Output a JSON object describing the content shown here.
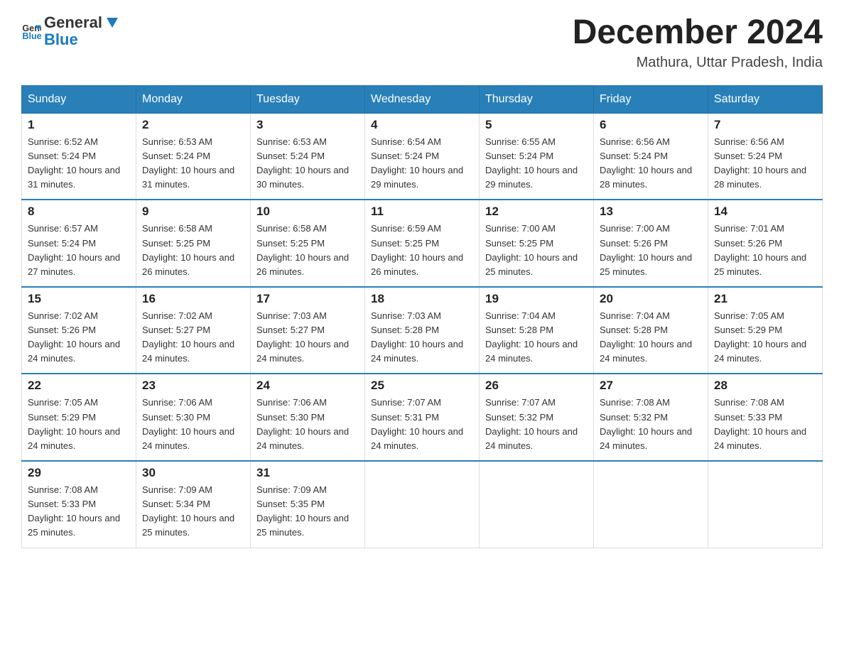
{
  "logo": {
    "general": "General",
    "blue": "Blue"
  },
  "title": "December 2024",
  "location": "Mathura, Uttar Pradesh, India",
  "headers": [
    "Sunday",
    "Monday",
    "Tuesday",
    "Wednesday",
    "Thursday",
    "Friday",
    "Saturday"
  ],
  "weeks": [
    [
      {
        "day": "1",
        "sunrise": "6:52 AM",
        "sunset": "5:24 PM",
        "daylight": "10 hours and 31 minutes."
      },
      {
        "day": "2",
        "sunrise": "6:53 AM",
        "sunset": "5:24 PM",
        "daylight": "10 hours and 31 minutes."
      },
      {
        "day": "3",
        "sunrise": "6:53 AM",
        "sunset": "5:24 PM",
        "daylight": "10 hours and 30 minutes."
      },
      {
        "day": "4",
        "sunrise": "6:54 AM",
        "sunset": "5:24 PM",
        "daylight": "10 hours and 29 minutes."
      },
      {
        "day": "5",
        "sunrise": "6:55 AM",
        "sunset": "5:24 PM",
        "daylight": "10 hours and 29 minutes."
      },
      {
        "day": "6",
        "sunrise": "6:56 AM",
        "sunset": "5:24 PM",
        "daylight": "10 hours and 28 minutes."
      },
      {
        "day": "7",
        "sunrise": "6:56 AM",
        "sunset": "5:24 PM",
        "daylight": "10 hours and 28 minutes."
      }
    ],
    [
      {
        "day": "8",
        "sunrise": "6:57 AM",
        "sunset": "5:24 PM",
        "daylight": "10 hours and 27 minutes."
      },
      {
        "day": "9",
        "sunrise": "6:58 AM",
        "sunset": "5:25 PM",
        "daylight": "10 hours and 26 minutes."
      },
      {
        "day": "10",
        "sunrise": "6:58 AM",
        "sunset": "5:25 PM",
        "daylight": "10 hours and 26 minutes."
      },
      {
        "day": "11",
        "sunrise": "6:59 AM",
        "sunset": "5:25 PM",
        "daylight": "10 hours and 26 minutes."
      },
      {
        "day": "12",
        "sunrise": "7:00 AM",
        "sunset": "5:25 PM",
        "daylight": "10 hours and 25 minutes."
      },
      {
        "day": "13",
        "sunrise": "7:00 AM",
        "sunset": "5:26 PM",
        "daylight": "10 hours and 25 minutes."
      },
      {
        "day": "14",
        "sunrise": "7:01 AM",
        "sunset": "5:26 PM",
        "daylight": "10 hours and 25 minutes."
      }
    ],
    [
      {
        "day": "15",
        "sunrise": "7:02 AM",
        "sunset": "5:26 PM",
        "daylight": "10 hours and 24 minutes."
      },
      {
        "day": "16",
        "sunrise": "7:02 AM",
        "sunset": "5:27 PM",
        "daylight": "10 hours and 24 minutes."
      },
      {
        "day": "17",
        "sunrise": "7:03 AM",
        "sunset": "5:27 PM",
        "daylight": "10 hours and 24 minutes."
      },
      {
        "day": "18",
        "sunrise": "7:03 AM",
        "sunset": "5:28 PM",
        "daylight": "10 hours and 24 minutes."
      },
      {
        "day": "19",
        "sunrise": "7:04 AM",
        "sunset": "5:28 PM",
        "daylight": "10 hours and 24 minutes."
      },
      {
        "day": "20",
        "sunrise": "7:04 AM",
        "sunset": "5:28 PM",
        "daylight": "10 hours and 24 minutes."
      },
      {
        "day": "21",
        "sunrise": "7:05 AM",
        "sunset": "5:29 PM",
        "daylight": "10 hours and 24 minutes."
      }
    ],
    [
      {
        "day": "22",
        "sunrise": "7:05 AM",
        "sunset": "5:29 PM",
        "daylight": "10 hours and 24 minutes."
      },
      {
        "day": "23",
        "sunrise": "7:06 AM",
        "sunset": "5:30 PM",
        "daylight": "10 hours and 24 minutes."
      },
      {
        "day": "24",
        "sunrise": "7:06 AM",
        "sunset": "5:30 PM",
        "daylight": "10 hours and 24 minutes."
      },
      {
        "day": "25",
        "sunrise": "7:07 AM",
        "sunset": "5:31 PM",
        "daylight": "10 hours and 24 minutes."
      },
      {
        "day": "26",
        "sunrise": "7:07 AM",
        "sunset": "5:32 PM",
        "daylight": "10 hours and 24 minutes."
      },
      {
        "day": "27",
        "sunrise": "7:08 AM",
        "sunset": "5:32 PM",
        "daylight": "10 hours and 24 minutes."
      },
      {
        "day": "28",
        "sunrise": "7:08 AM",
        "sunset": "5:33 PM",
        "daylight": "10 hours and 24 minutes."
      }
    ],
    [
      {
        "day": "29",
        "sunrise": "7:08 AM",
        "sunset": "5:33 PM",
        "daylight": "10 hours and 25 minutes."
      },
      {
        "day": "30",
        "sunrise": "7:09 AM",
        "sunset": "5:34 PM",
        "daylight": "10 hours and 25 minutes."
      },
      {
        "day": "31",
        "sunrise": "7:09 AM",
        "sunset": "5:35 PM",
        "daylight": "10 hours and 25 minutes."
      },
      null,
      null,
      null,
      null
    ]
  ],
  "labels": {
    "sunrise": "Sunrise:",
    "sunset": "Sunset:",
    "daylight": "Daylight:"
  }
}
